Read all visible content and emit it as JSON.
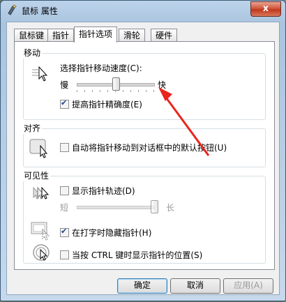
{
  "window": {
    "title": "鼠标 属性",
    "close_glyph": "x"
  },
  "tabs": [
    {
      "label": "鼠标键",
      "active": false
    },
    {
      "label": "指针",
      "active": false
    },
    {
      "label": "指针选项",
      "active": true
    },
    {
      "label": "滑轮",
      "active": false
    },
    {
      "label": "硬件",
      "active": false
    }
  ],
  "motion": {
    "group_title": "移动",
    "speed_label": "选择指针移动速度(C):",
    "slow": "慢",
    "fast": "快",
    "speed_level": 0.5,
    "precision_label": "提高指针精确度(E)",
    "precision_checked": true
  },
  "snap": {
    "group_title": "对齐",
    "label": "自动将指针移动到对话框中的默认按钮(U)",
    "checked": false
  },
  "visibility": {
    "group_title": "可见性",
    "trails_label": "显示指针轨迹(D)",
    "trails_checked": false,
    "short": "短",
    "long": "长",
    "trails_level": 1.0,
    "hide_label": "在打字时隐藏指针(H)",
    "hide_checked": true,
    "ctrl_label": "当按 CTRL 键时显示指针的位置(S)",
    "ctrl_checked": false
  },
  "buttons": {
    "ok": "确定",
    "cancel": "取消",
    "apply": "应用(A)"
  },
  "colors": {
    "annotation_arrow": "#e8251c",
    "accent": "#3c7fb1"
  }
}
